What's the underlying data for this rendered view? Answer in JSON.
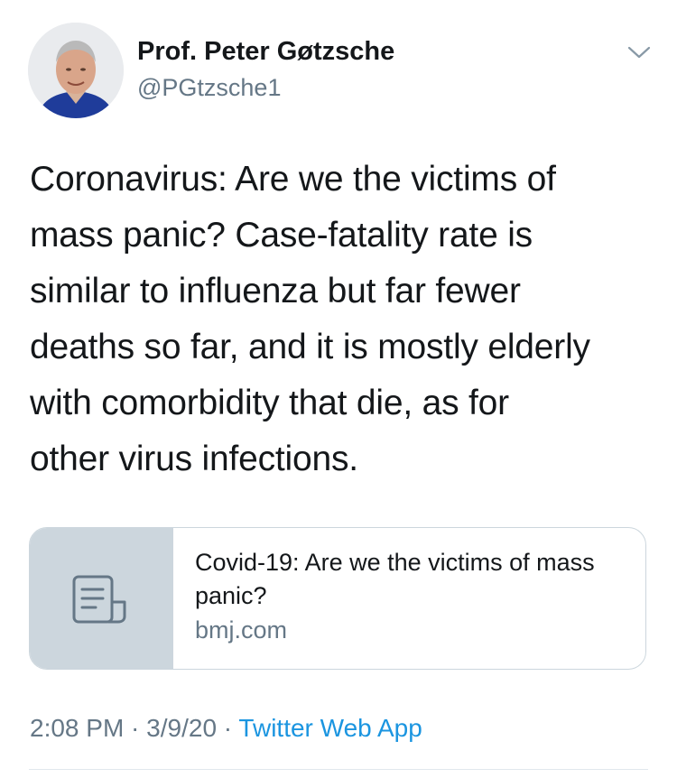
{
  "author": {
    "name": "Prof. Peter Gøtzsche",
    "handle": "@PGtzsche1"
  },
  "tweet": {
    "text": "Coronavirus: Are we the victims of\nmass panic? Case-fatality rate is\nsimilar to influenza but far fewer\ndeaths so far, and it is mostly elderly\nwith comorbidity that die, as for\nother virus infections."
  },
  "card": {
    "title": "Covid-19: Are we the victims of mass panic?",
    "domain": "bmj.com",
    "icon": "document-icon"
  },
  "meta": {
    "time": "2:08 PM",
    "separator1": " · ",
    "date": "3/9/20",
    "separator2": " · ",
    "source": "Twitter Web App"
  },
  "colors": {
    "text": "#14171a",
    "secondary": "#657786",
    "link": "#1b95e0",
    "card_border": "#ccd6dd",
    "card_thumb": "#ccd6dd"
  }
}
